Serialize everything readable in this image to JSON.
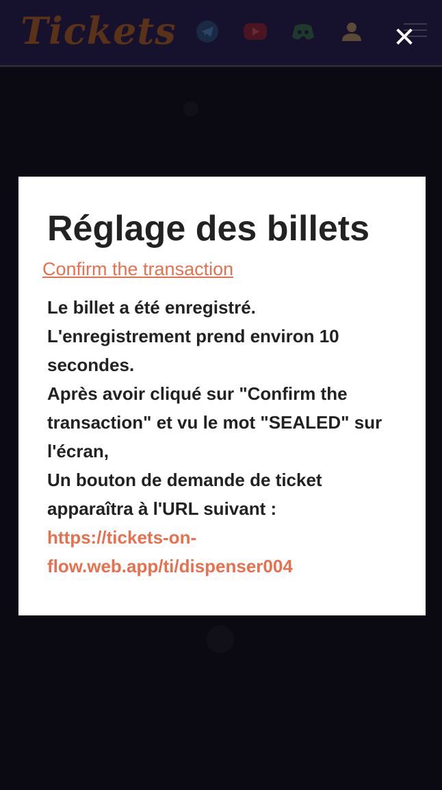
{
  "header": {
    "logo_text": "Tickets",
    "icons": [
      "telegram-icon",
      "youtube-icon",
      "discord-icon",
      "user-icon",
      "menu-icon"
    ],
    "close_glyph": "✕"
  },
  "modal": {
    "title": "Réglage des billets",
    "confirm_link": "Confirm the transaction",
    "lines": [
      "Le billet a été enregistré.",
      "L'enregistrement prend environ 10 secondes.",
      "Après avoir cliqué sur \"Confirm the transaction\" et vu le mot \"SEALED\" sur l'écran,",
      "Un bouton de demande de ticket apparaîtra à l'URL suivant :"
    ],
    "url": "https://tickets-on-flow.web.app/ti/dispenser004"
  },
  "colors": {
    "accent": "#e8704e",
    "header_bg": "#16122e",
    "page_bg": "#0b0a12",
    "modal_bg": "#ffffff",
    "text": "#222222"
  }
}
